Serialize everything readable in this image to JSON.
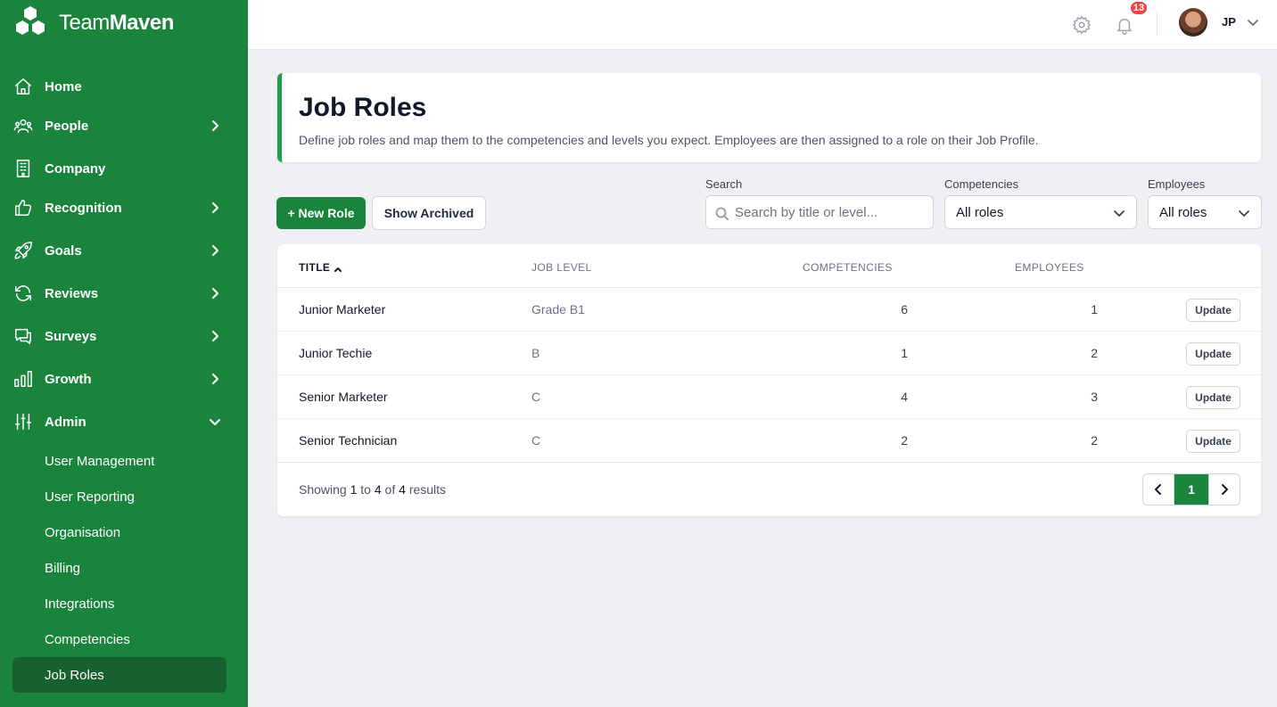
{
  "brand": {
    "name_light": "Team",
    "name_bold": "Maven"
  },
  "nav": {
    "items": [
      {
        "label": "Home",
        "icon": "home-icon",
        "chevron": ""
      },
      {
        "label": "People",
        "icon": "people-icon",
        "chevron": "right"
      },
      {
        "label": "Company",
        "icon": "building-icon",
        "chevron": ""
      },
      {
        "label": "Recognition",
        "icon": "thumbs-up-icon",
        "chevron": "right"
      },
      {
        "label": "Goals",
        "icon": "rocket-icon",
        "chevron": "right"
      },
      {
        "label": "Reviews",
        "icon": "refresh-icon",
        "chevron": "right"
      },
      {
        "label": "Surveys",
        "icon": "chat-icon",
        "chevron": "right"
      },
      {
        "label": "Growth",
        "icon": "bar-chart-icon",
        "chevron": "right"
      },
      {
        "label": "Admin",
        "icon": "sliders-icon",
        "chevron": "down"
      }
    ],
    "admin_sub": [
      {
        "label": "User Management"
      },
      {
        "label": "User Reporting"
      },
      {
        "label": "Organisation"
      },
      {
        "label": "Billing"
      },
      {
        "label": "Integrations"
      },
      {
        "label": "Competencies"
      },
      {
        "label": "Job Roles",
        "active": true
      }
    ]
  },
  "topbar": {
    "notification_count": "13",
    "user_initials": "JP"
  },
  "header": {
    "title": "Job Roles",
    "description": "Define job roles and map them to the competencies and levels you expect. Employees are then assigned to a role on their Job Profile."
  },
  "toolbar": {
    "new_role_label": "+ New Role",
    "show_archived_label": "Show Archived",
    "search_label": "Search",
    "search_placeholder": "Search by title or level...",
    "competencies_label": "Competencies",
    "competencies_value": "All roles",
    "employees_label": "Employees",
    "employees_value": "All roles"
  },
  "table": {
    "headers": {
      "title": "TITLE",
      "level": "JOB LEVEL",
      "competencies": "COMPETENCIES",
      "employees": "EMPLOYEES"
    },
    "update_label": "Update",
    "rows": [
      {
        "title": "Junior Marketer",
        "level": "Grade B1",
        "competencies": "6",
        "employees": "1"
      },
      {
        "title": "Junior Techie",
        "level": "B",
        "competencies": "1",
        "employees": "2"
      },
      {
        "title": "Senior Marketer",
        "level": "C",
        "competencies": "4",
        "employees": "3"
      },
      {
        "title": "Senior Technician",
        "level": "C",
        "competencies": "2",
        "employees": "2"
      }
    ],
    "footer": {
      "prefix": "Showing",
      "from": "1",
      "to_word": "to",
      "to": "4",
      "of_word": "of",
      "total": "4",
      "suffix": "results"
    },
    "current_page": "1"
  },
  "colors": {
    "brand_green": "#1a843d",
    "active_nav": "#17602f",
    "badge_red": "#ef4444"
  }
}
